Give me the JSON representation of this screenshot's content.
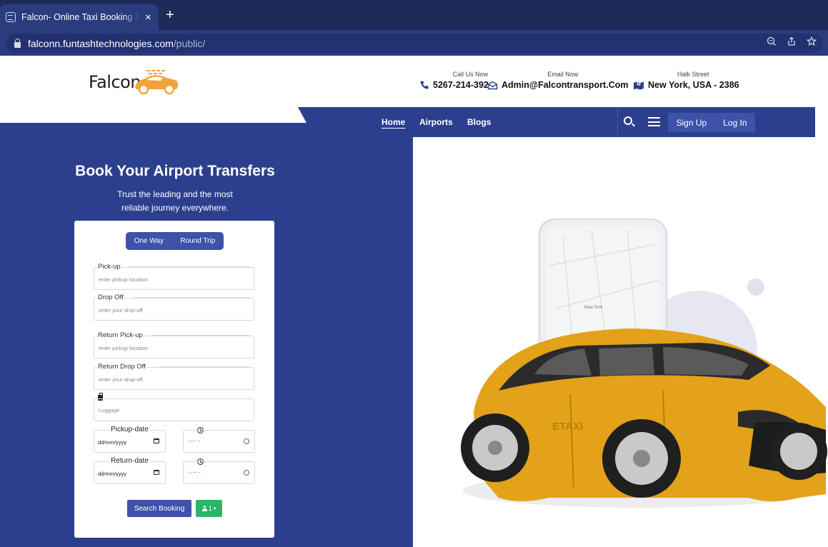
{
  "browser": {
    "tab_title": "Falcon- Online Taxi Booking Se",
    "close_glyph": "×",
    "new_tab_glyph": "+",
    "url_host": "falconn.funtashtechnologies.com",
    "url_path": "/public/",
    "icons": [
      "zoom-icon",
      "share-icon",
      "bookmark-star-icon"
    ]
  },
  "header": {
    "logo_text": "Falcon",
    "brand_color": "#f0a43a",
    "contacts": [
      {
        "label": "Call Us Now",
        "value": "5267-214-392",
        "icon": "phone-icon"
      },
      {
        "label": "Email Now",
        "value": "Admin@Falcontransport.Com",
        "icon": "envelope-icon"
      },
      {
        "label": "Halk Street",
        "value": "New York, USA - 2386",
        "icon": "map-icon"
      }
    ]
  },
  "nav": {
    "links": [
      "Home",
      "Airports",
      "Blogs"
    ],
    "active": "Home",
    "sign_up": "Sign Up",
    "log_in": "Log In",
    "primary_color": "#2c3f8f"
  },
  "hero": {
    "title": "Book Your Airport Transfers",
    "subtitle_line1": "Trust the leading and the most",
    "subtitle_line2": "reliable journey everywhere."
  },
  "booking": {
    "trip_types": [
      "One Way",
      "Round Trip"
    ],
    "fields": {
      "pickup": {
        "label": "Pick-up",
        "placeholder": "enter pickup location"
      },
      "dropoff": {
        "label": "Drop Off",
        "placeholder": "enter your drop-off"
      },
      "return_pickup": {
        "label": "Return Pick-up",
        "placeholder": "enter pickup location"
      },
      "return_dropoff": {
        "label": "Return Drop Off",
        "placeholder": "enter your drop-off"
      },
      "luggage": {
        "placeholder": "Luggage"
      }
    },
    "pickup_date": {
      "label": "Pickup-date",
      "value": "dd/mm/yyyy"
    },
    "return_date": {
      "label": "Return-date",
      "value": "dd/mm/yyyy"
    },
    "time_value": "--:-- --",
    "search_label": "Search Booking",
    "passengers": "1",
    "passenger_caret": "▾",
    "accent_green": "#2eb46a"
  },
  "illustration": {
    "map_city": "New York",
    "car_door_text": "ETAXI",
    "car_color": "#e3a21a"
  }
}
